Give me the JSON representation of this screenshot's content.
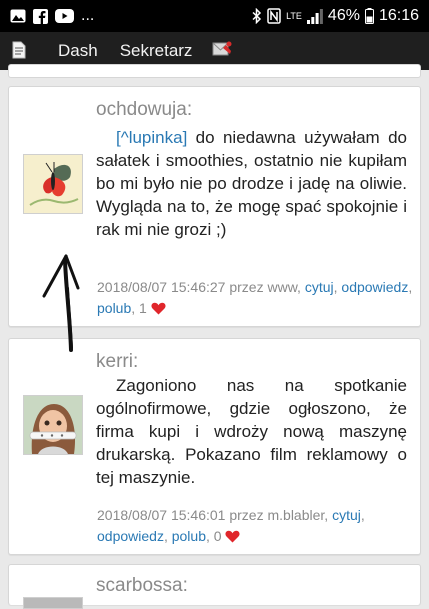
{
  "status_bar": {
    "dots": "...",
    "network": "LTE",
    "battery": "46%",
    "time": "16:16",
    "icons": [
      "image-icon",
      "facebook-icon",
      "youtube-icon",
      "bluetooth-icon",
      "nfc-icon",
      "signal-icon",
      "battery-icon"
    ]
  },
  "app_bar": {
    "tabs": [
      {
        "label": "Dash"
      },
      {
        "label": "Sekretarz"
      }
    ],
    "icons": [
      "document-icon",
      "mail-icon"
    ]
  },
  "posts": [
    {
      "author": "ochdowuja:",
      "avatar": "butterfly-avatar",
      "mention": "[^lupinka]",
      "text": " do niedawna używałam do sałatek i smoothies, ostatnio nie kupiłam bo mi było nie po drodze i jadę na oliwie. Wygląda na to, że mogę spać spokojnie i rak mi nie grozi ;)",
      "timestamp": "2018/08/07  15:46:27",
      "by_label": "przez www,",
      "actions": {
        "quote": "cytuj",
        "reply": "odpowiedz",
        "like": "polub"
      },
      "likes": ", 1"
    },
    {
      "author": "kerri:",
      "avatar": "doll-avatar",
      "text": "Zagoniono nas na spotkanie ogólnofirmowe, gdzie ogłoszono, że firma kupi i wdroży nową maszynę drukarską. Pokazano film reklamowy o tej maszynie.",
      "timestamp": "2018/08/07 15:46:01",
      "by_label": "przez m.blabler,",
      "actions": {
        "quote": "cytuj",
        "reply": "odpowiedz",
        "like": "polub"
      },
      "likes": ", 0"
    },
    {
      "author": "scarbossa:"
    }
  ],
  "colors": {
    "link": "#2a79b4",
    "heart": "#e0262b",
    "author": "#8a8a8a",
    "app_bar": "#1f1f1f"
  }
}
